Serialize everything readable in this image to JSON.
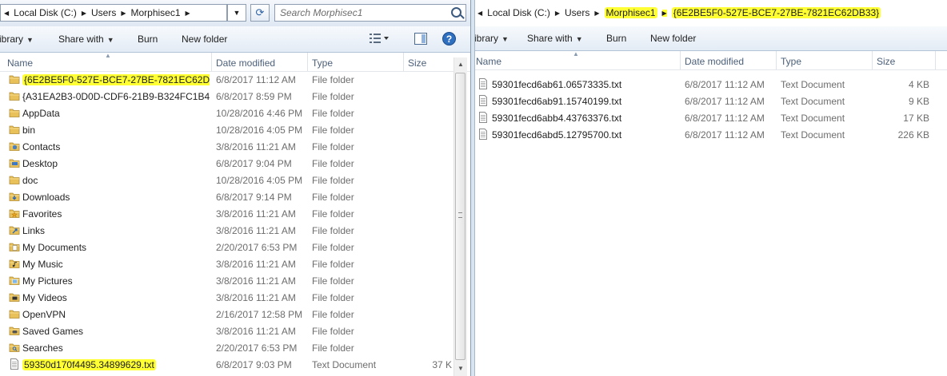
{
  "left": {
    "breadcrumb": [
      "Local Disk (C:)",
      "Users",
      "Morphisec1"
    ],
    "search_placeholder": "Search Morphisec1",
    "toolbar": {
      "library": "ibrary",
      "share_with": "Share with",
      "burn": "Burn",
      "new_folder": "New folder"
    },
    "columns": {
      "name": "Name",
      "date": "Date modified",
      "type": "Type",
      "size": "Size"
    },
    "rows": [
      {
        "name": "{6E2BE5F0-527E-BCE7-27BE-7821EC62DB...",
        "date": "6/8/2017 11:12 AM",
        "type": "File folder",
        "size": "",
        "icon": "folder-icon",
        "highlight": true
      },
      {
        "name": "{A31EA2B3-0D0D-CDF6-21B9-B324FC1B4...",
        "date": "6/8/2017 8:59 PM",
        "type": "File folder",
        "size": "",
        "icon": "folder-icon",
        "highlight": false
      },
      {
        "name": "AppData",
        "date": "10/28/2016 4:46 PM",
        "type": "File folder",
        "size": "",
        "icon": "folder-icon",
        "highlight": false
      },
      {
        "name": "bin",
        "date": "10/28/2016 4:05 PM",
        "type": "File folder",
        "size": "",
        "icon": "folder-icon",
        "highlight": false
      },
      {
        "name": "Contacts",
        "date": "3/8/2016 11:21 AM",
        "type": "File folder",
        "size": "",
        "icon": "contacts-folder-icon",
        "highlight": false
      },
      {
        "name": "Desktop",
        "date": "6/8/2017 9:04 PM",
        "type": "File folder",
        "size": "",
        "icon": "desktop-folder-icon",
        "highlight": false
      },
      {
        "name": "doc",
        "date": "10/28/2016 4:05 PM",
        "type": "File folder",
        "size": "",
        "icon": "folder-icon",
        "highlight": false
      },
      {
        "name": "Downloads",
        "date": "6/8/2017 9:14 PM",
        "type": "File folder",
        "size": "",
        "icon": "downloads-folder-icon",
        "highlight": false
      },
      {
        "name": "Favorites",
        "date": "3/8/2016 11:21 AM",
        "type": "File folder",
        "size": "",
        "icon": "favorites-folder-icon",
        "highlight": false
      },
      {
        "name": "Links",
        "date": "3/8/2016 11:21 AM",
        "type": "File folder",
        "size": "",
        "icon": "links-folder-icon",
        "highlight": false
      },
      {
        "name": "My Documents",
        "date": "2/20/2017 6:53 PM",
        "type": "File folder",
        "size": "",
        "icon": "documents-folder-icon",
        "highlight": false
      },
      {
        "name": "My Music",
        "date": "3/8/2016 11:21 AM",
        "type": "File folder",
        "size": "",
        "icon": "music-folder-icon",
        "highlight": false
      },
      {
        "name": "My Pictures",
        "date": "3/8/2016 11:21 AM",
        "type": "File folder",
        "size": "",
        "icon": "pictures-folder-icon",
        "highlight": false
      },
      {
        "name": "My Videos",
        "date": "3/8/2016 11:21 AM",
        "type": "File folder",
        "size": "",
        "icon": "videos-folder-icon",
        "highlight": false
      },
      {
        "name": "OpenVPN",
        "date": "2/16/2017 12:58 PM",
        "type": "File folder",
        "size": "",
        "icon": "folder-icon",
        "highlight": false
      },
      {
        "name": "Saved Games",
        "date": "3/8/2016 11:21 AM",
        "type": "File folder",
        "size": "",
        "icon": "saved-games-folder-icon",
        "highlight": false
      },
      {
        "name": "Searches",
        "date": "2/20/2017 6:53 PM",
        "type": "File folder",
        "size": "",
        "icon": "searches-folder-icon",
        "highlight": false
      },
      {
        "name": "59350d170f4495.34899629.txt",
        "date": "6/8/2017 9:03 PM",
        "type": "Text Document",
        "size": "37 K",
        "icon": "text-file-icon",
        "highlight": true
      }
    ]
  },
  "right": {
    "breadcrumb": [
      "Local Disk (C:)",
      "Users",
      "Morphisec1",
      "{6E2BE5F0-527E-BCE7-27BE-7821EC62DB33}"
    ],
    "toolbar": {
      "library": "ibrary",
      "share_with": "Share with",
      "burn": "Burn",
      "new_folder": "New folder"
    },
    "columns": {
      "name": "Name",
      "date": "Date modified",
      "type": "Type",
      "size": "Size"
    },
    "rows": [
      {
        "name": "59301fecd6ab61.06573335.txt",
        "date": "6/8/2017 11:12 AM",
        "type": "Text Document",
        "size": "4 KB",
        "icon": "text-file-icon"
      },
      {
        "name": "59301fecd6ab91.15740199.txt",
        "date": "6/8/2017 11:12 AM",
        "type": "Text Document",
        "size": "9 KB",
        "icon": "text-file-icon"
      },
      {
        "name": "59301fecd6abb4.43763376.txt",
        "date": "6/8/2017 11:12 AM",
        "type": "Text Document",
        "size": "17 KB",
        "icon": "text-file-icon"
      },
      {
        "name": "59301fecd6abd5.12795700.txt",
        "date": "6/8/2017 11:12 AM",
        "type": "Text Document",
        "size": "226 KB",
        "icon": "text-file-icon"
      }
    ]
  },
  "colors": {
    "highlight": "#ffff33",
    "folder": "#e8c15a",
    "header_text": "#4c607a",
    "muted_text": "#6d6d6d"
  }
}
